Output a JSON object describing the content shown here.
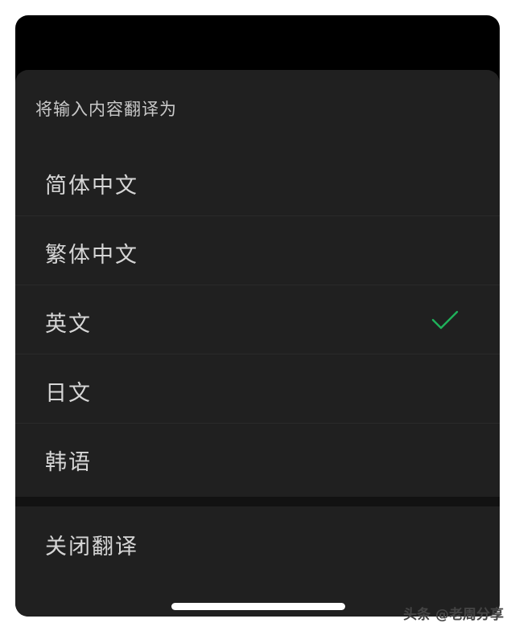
{
  "sheet": {
    "title": "将输入内容翻译为"
  },
  "options": [
    {
      "label": "简体中文",
      "selected": false
    },
    {
      "label": "繁体中文",
      "selected": false
    },
    {
      "label": "英文",
      "selected": true
    },
    {
      "label": "日文",
      "selected": false
    },
    {
      "label": "韩语",
      "selected": false
    }
  ],
  "close_label": "关闭翻译",
  "check_icon": "checkmark-icon",
  "colors": {
    "sheet_bg": "#202020",
    "check": "#1fb15a",
    "text": "#d6d6d6"
  },
  "watermark": "头条 @老周分享"
}
